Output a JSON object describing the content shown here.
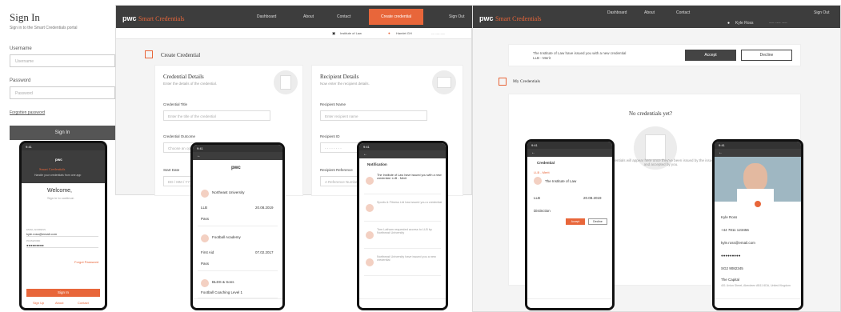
{
  "signin": {
    "title": "Sign In",
    "subtitle": "Sign in to the Smart Credentials portal",
    "username_label": "Username",
    "username_placeholder": "Username",
    "password_label": "Password",
    "password_placeholder": "Password",
    "forgot": "Forgotten password",
    "button": "Sign In"
  },
  "brand": {
    "logo": "pwc",
    "name": "Smart Credentials"
  },
  "nav": {
    "dashboard": "Dashboard",
    "about": "About",
    "contact": "Contact",
    "create": "Create credential",
    "signout": "Sign Out"
  },
  "subbar": {
    "org": "Institute of Law",
    "user": "Hamlet GH",
    "account": "--- ---- ----"
  },
  "create": {
    "title": "Create Credential",
    "cred_title": "Credential Details",
    "cred_sub": "Enter the details of the credential.",
    "f_title": "Credential Title",
    "f_title_ph": "Enter the title of the credential",
    "f_outcome": "Credential Outcome",
    "f_outcome_ph": "Choose an option",
    "f_start": "Start Date",
    "f_start_ph": "DD / MM / YYYY",
    "rec_title": "Recipient Details",
    "rec_sub": "Now enter the recipient details.",
    "r_name": "Recipient Name",
    "r_name_ph": "Enter recipient name",
    "r_id": "Recipient ID",
    "r_id_ph": "- - - - - - - -",
    "r_ref": "Recipient Reference",
    "r_ref_ph": "A Reference Number"
  },
  "dashboard": {
    "user": "Kyle Ross",
    "account": "---- ---- ----",
    "notice": "The Institute of Law have issued you with a new credential",
    "notice_sub": "LLB - Merit",
    "accept": "Accept",
    "decline": "Decline",
    "my_creds": "My Credentials",
    "empty": "No credentials yet?",
    "empty_sub": "Credentials will appear here once they've been issued by the issuer and accepted by you."
  },
  "mobile1": {
    "time": "9:41",
    "brand": "Smart Credentials",
    "tagline": "Handle your credentials from one app",
    "welcome": "Welcome,",
    "sub": "Sign in to continue.",
    "email_label": "EMAIL ADDRESS",
    "email": "kyle.ross@email.com",
    "pwd_label": "PASSWORD",
    "pwd": "●●●●●●●●●",
    "forgot": "Forgot Password",
    "btn": "Sign In",
    "links": [
      "Sign Up",
      "About",
      "Contact"
    ]
  },
  "mobile2": {
    "time": "9:41",
    "items": [
      {
        "name": "Northeast University",
        "d1": "LLB",
        "d2": "20.08.2019",
        "d3": "Pass"
      },
      {
        "name": "Football Academy",
        "d1": "First Aid",
        "d2": "07.02.2017",
        "d3": "Pass"
      },
      {
        "name": "BLDS & Sons",
        "d1": "Football Coaching Level 1",
        "d2": "",
        "d3": ""
      }
    ]
  },
  "mobile3": {
    "time": "9:41",
    "title": "Notification",
    "items": [
      "The Institute of Law have issued you with a new credential: LLB - Merit",
      "Sports & Fitness Ltd has issued you a credential",
      "Tom Latham requested access to LLB by Northeast University",
      "Northeast University have issued you a new credential"
    ]
  },
  "mobile4": {
    "time": "9:41",
    "title": "Credential",
    "tag": "LLB - Merit",
    "issuer": "The Institute of Law",
    "l1": "LLB",
    "l2": "20.08.2019",
    "l3": "Distinction",
    "accept": "Accept",
    "decline": "Decline"
  },
  "mobile5": {
    "time": "9:41",
    "name": "Kyle Ross",
    "phone": "+44 7811 123456",
    "email": "kyle.ross@email.com",
    "pwd": "●●●●●●●●●",
    "ni": "SG2 9082345",
    "company": "The Capital",
    "address": "401 Union Street, Aberdeen AB11 6DA, United Kingdom"
  },
  "colors": {
    "accent": "#e8663a",
    "dark": "#3d3d3d"
  }
}
